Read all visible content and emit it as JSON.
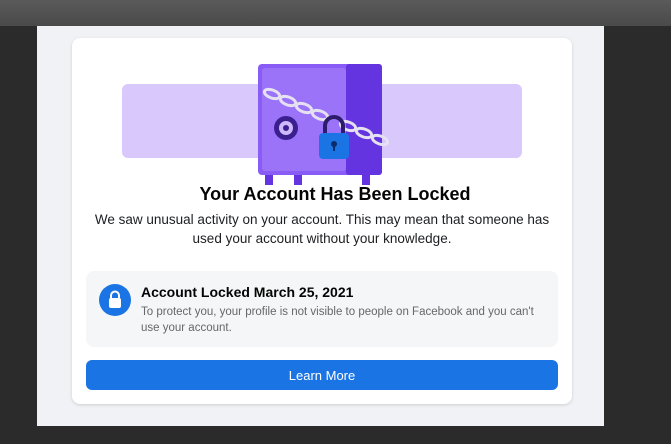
{
  "illustration": {
    "icon": "locked-safe-illustration",
    "lock_icon": "padlock-icon"
  },
  "card": {
    "title": "Your Account Has Been Locked",
    "description": "We saw unusual activity on your account. This may mean that someone has used your account without your knowledge."
  },
  "notice": {
    "icon": "lock-icon",
    "title": "Account Locked March 25, 2021",
    "body": "To protect you, your profile is not visible to people on Facebook and you can't use your account."
  },
  "actions": {
    "learn_more_label": "Learn More"
  },
  "colors": {
    "primary": "#1b74e4",
    "illustration_band": "#d9c8fb",
    "safe": "#8a5cf6",
    "safe_dark": "#6434e0",
    "page_background": "#f0f2f5"
  }
}
